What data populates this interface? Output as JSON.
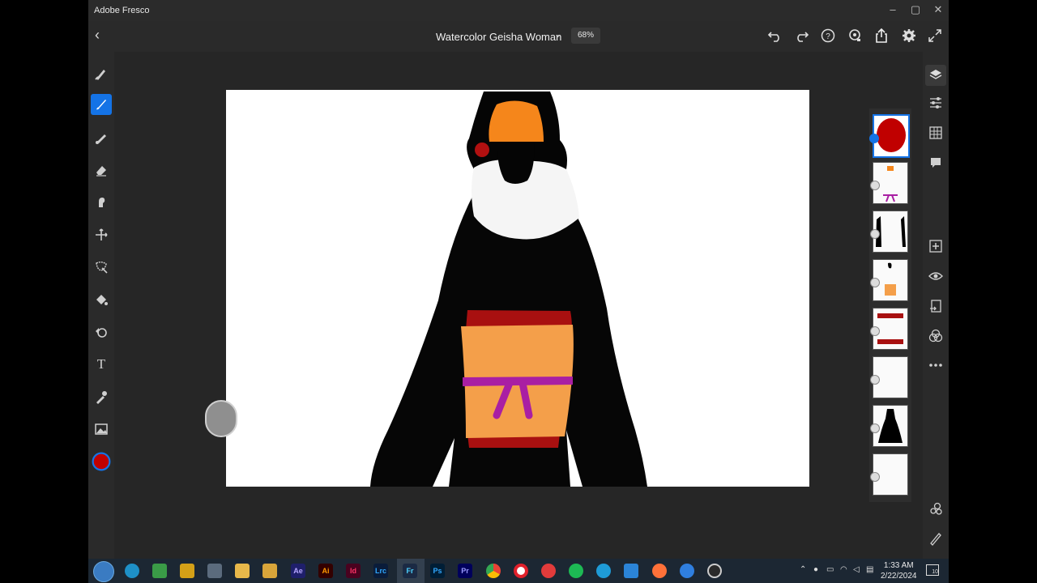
{
  "window": {
    "app_title": "Adobe Fresco",
    "minimize": "–",
    "maximize": "▢",
    "close": "✕"
  },
  "header": {
    "back": "‹",
    "doc_title": "Watercolor Geisha Woman",
    "doc_caret": "⌄",
    "zoom": "68%",
    "icons": [
      "undo-icon",
      "redo-icon",
      "help-icon",
      "learn-icon",
      "share-icon",
      "settings-icon",
      "fullscreen-icon"
    ]
  },
  "toolbar": {
    "tools": [
      "pixel-brush-icon",
      "live-brush-icon",
      "vector-brush-icon",
      "eraser-icon",
      "smudge-icon",
      "move-icon",
      "selection-icon",
      "fill-icon",
      "shapes-icon",
      "type-icon",
      "eyedropper-icon",
      "place-image-icon",
      "color-icon"
    ],
    "active_tool": "live-brush-icon",
    "text_tool_label": "T"
  },
  "brush_settings": {
    "size": "27",
    "color": "#c00000"
  },
  "layers_panel": {
    "count": 8,
    "selected_index": 0
  },
  "right_icons": [
    "layers-icon",
    "layer-properties-icon",
    "grid-icon",
    "comment-icon",
    "add-layer-icon",
    "visibility-icon",
    "import-icon",
    "blend-icon",
    "more-icon",
    "motion-icon",
    "edit-icon"
  ],
  "taskbar": {
    "apps": [
      {
        "name": "Ae",
        "color": "#1f1f6b"
      },
      {
        "name": "Ai",
        "color": "#330000"
      },
      {
        "name": "Id",
        "color": "#49021f"
      },
      {
        "name": "Lrc",
        "color": "#0a1c3a"
      },
      {
        "name": "Fr",
        "color": "#1b2a44"
      },
      {
        "name": "Ps",
        "color": "#001e36"
      },
      {
        "name": "Pr",
        "color": "#00005b"
      }
    ],
    "time": "1:33 AM",
    "date": "2/22/2024",
    "notification_count": "10"
  },
  "colors": {
    "accent": "#1473e6",
    "brush_red": "#c00000",
    "purple": "#a91fa3",
    "orange": "#f49f4a",
    "dark_red": "#a81010"
  }
}
